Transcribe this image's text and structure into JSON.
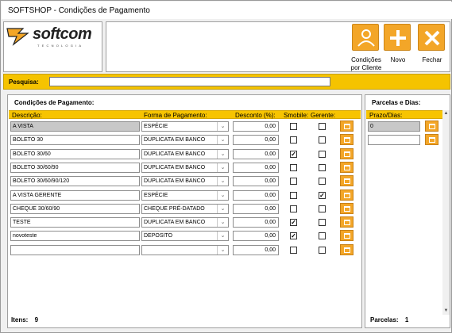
{
  "window": {
    "title": "SOFTSHOP - Condições de Pagamento"
  },
  "logo": {
    "text": "softcom",
    "subtitle": "TECNOLOGIA"
  },
  "toolbar": {
    "condicoes_label_1": "Condições",
    "condicoes_label_2": "por Cliente",
    "novo_label": "Novo",
    "fechar_label": "Fechar"
  },
  "search": {
    "label": "Pesquisa:",
    "value": ""
  },
  "conditions": {
    "title": "Condições de Pagamento:",
    "headers": {
      "descricao": "Descrição:",
      "forma": "Forma de Pagamento:",
      "desconto": "Desconto (%):",
      "smobile": "Smobile:",
      "gerente": "Gerente:"
    },
    "rows": [
      {
        "descricao": "A VISTA",
        "forma": "ESPÉCIE",
        "desconto": "0,00",
        "smobile": false,
        "gerente": false,
        "selected": true
      },
      {
        "descricao": "BOLETO 30",
        "forma": "DUPLICATA EM BANCO",
        "desconto": "0,00",
        "smobile": false,
        "gerente": false
      },
      {
        "descricao": "BOLETO 30/60",
        "forma": "DUPLICATA EM BANCO",
        "desconto": "0,00",
        "smobile": true,
        "gerente": false
      },
      {
        "descricao": "BOLETO 30/60/90",
        "forma": "DUPLICATA EM BANCO",
        "desconto": "0,00",
        "smobile": false,
        "gerente": false
      },
      {
        "descricao": "BOLETO 30/60/90/120",
        "forma": "DUPLICATA EM BANCO",
        "desconto": "0,00",
        "smobile": false,
        "gerente": false
      },
      {
        "descricao": "A VISTA GERENTE",
        "forma": "ESPÉCIE",
        "desconto": "0,00",
        "smobile": false,
        "gerente": true
      },
      {
        "descricao": "CHEQUE 30/60/90",
        "forma": "CHEQUE PRÉ-DATADO",
        "desconto": "0,00",
        "smobile": false,
        "gerente": false
      },
      {
        "descricao": "TESTE",
        "forma": "DUPLICATA EM BANCO",
        "desconto": "0,00",
        "smobile": true,
        "gerente": false
      },
      {
        "descricao": "novoteste",
        "forma": "DEPOSITO",
        "desconto": "0,00",
        "smobile": true,
        "gerente": false
      },
      {
        "descricao": "",
        "forma": "",
        "desconto": "0,00",
        "smobile": false,
        "gerente": false
      }
    ],
    "footer_label": "Itens:",
    "footer_count": "9"
  },
  "parcelas": {
    "title": "Parcelas e Dias:",
    "header": "Prazo/Dias:",
    "rows": [
      {
        "value": "0",
        "selected": true
      },
      {
        "value": "",
        "selected": false
      }
    ],
    "footer_label": "Parcelas:",
    "footer_count": "1"
  },
  "colors": {
    "accent": "#f3a628",
    "header": "#f7c400"
  }
}
